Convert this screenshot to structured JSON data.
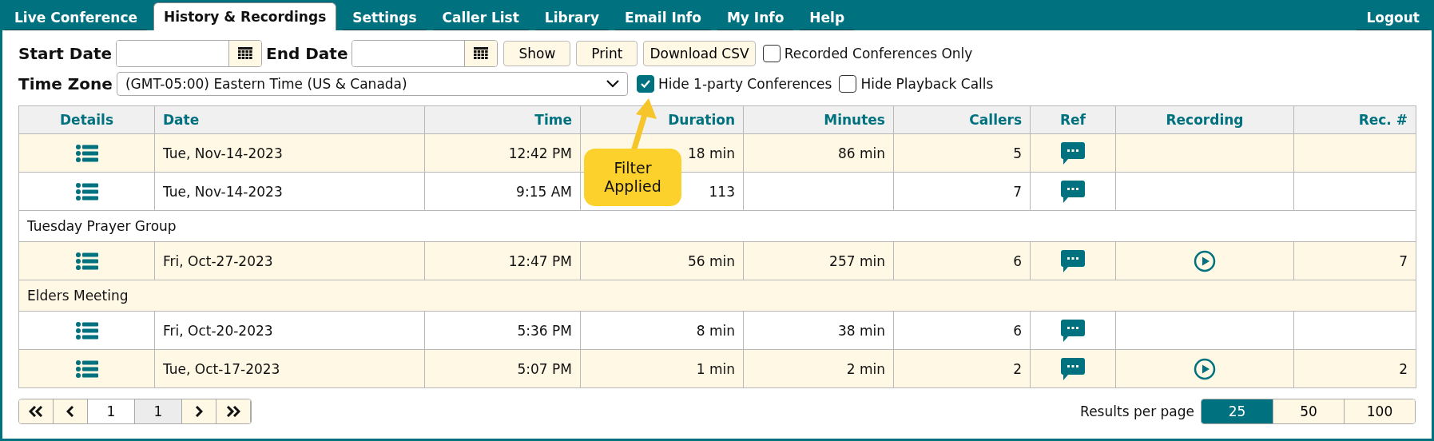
{
  "nav": {
    "tabs": [
      {
        "label": "Live Conference",
        "selected": false
      },
      {
        "label": "History & Recordings",
        "selected": true
      },
      {
        "label": "Settings",
        "selected": false
      },
      {
        "label": "Caller List",
        "selected": false
      },
      {
        "label": "Library",
        "selected": false
      },
      {
        "label": "Email Info",
        "selected": false
      },
      {
        "label": "My Info",
        "selected": false
      },
      {
        "label": "Help",
        "selected": false
      }
    ],
    "logout": "Logout"
  },
  "filters": {
    "start_date_label": "Start Date",
    "end_date_label": "End Date",
    "buttons": [
      "Show",
      "Print",
      "Download CSV"
    ],
    "recorded_only": {
      "label": "Recorded Conferences Only",
      "checked": false
    },
    "time_zone_label": "Time Zone",
    "time_zone": "(GMT-05:00) Eastern Time (US & Canada)",
    "hide_one_party": {
      "label": "Hide 1-party Conferences",
      "checked": true
    },
    "hide_playback": {
      "label": "Hide Playback Calls",
      "checked": false
    }
  },
  "table": {
    "columns": [
      "Details",
      "Date",
      "Time",
      "Duration",
      "Minutes",
      "Callers",
      "Ref",
      "Recording",
      "Rec. #"
    ],
    "rows": [
      {
        "kind": "call",
        "highlighted": true,
        "date": "Tue, Nov-14-2023",
        "time": "12:42 PM",
        "duration": "18 min",
        "minutes": "86 min",
        "callers": "5",
        "recording": false
      },
      {
        "kind": "call",
        "highlighted": false,
        "date": "Tue, Nov-14-2023",
        "time": "9:15 AM",
        "duration": "113",
        "callers": "7",
        "recording": false
      },
      {
        "kind": "group",
        "highlighted": false,
        "name": "Tuesday Prayer Group"
      },
      {
        "kind": "call",
        "highlighted": true,
        "date": "Fri, Oct-27-2023",
        "time": "12:47 PM",
        "duration": "56 min",
        "minutes": "257 min",
        "callers": "6",
        "recording": true,
        "rec_no": "7"
      },
      {
        "kind": "group",
        "highlighted": true,
        "name": "Elders Meeting"
      },
      {
        "kind": "call",
        "highlighted": false,
        "date": "Fri, Oct-20-2023",
        "time": "5:36 PM",
        "duration": "8 min",
        "minutes": "38 min",
        "callers": "6",
        "recording": false
      },
      {
        "kind": "call",
        "highlighted": true,
        "date": "Tue, Oct-17-2023",
        "time": "5:07 PM",
        "duration": "1 min",
        "minutes": "2 min",
        "callers": "2",
        "recording": true,
        "rec_no": "2"
      }
    ]
  },
  "callout": {
    "text": "Filter Applied"
  },
  "pager": {
    "page": "1",
    "total": "1"
  },
  "per_page": {
    "label": "Results per page",
    "options": [
      {
        "label": "25",
        "selected": true
      },
      {
        "label": "50",
        "selected": false
      },
      {
        "label": "100",
        "selected": false
      }
    ]
  }
}
